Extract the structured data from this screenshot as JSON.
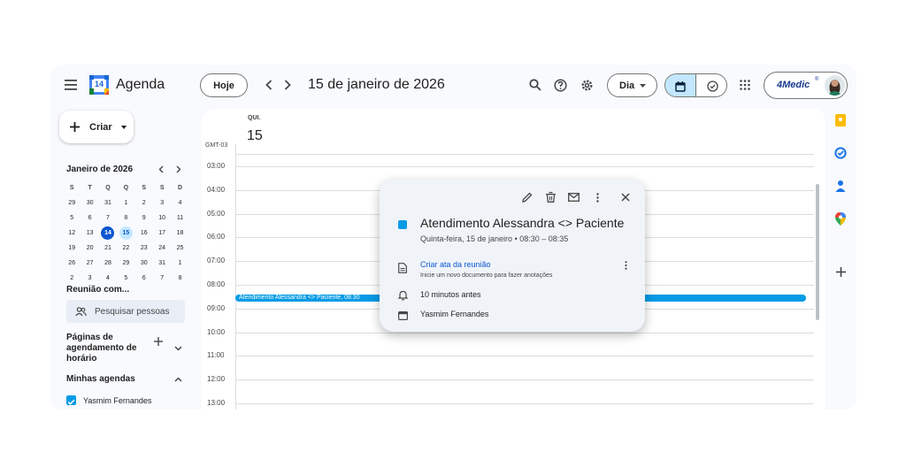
{
  "header": {
    "app_title": "Agenda",
    "calendar_logo_day": "14",
    "today_button": "Hoje",
    "prev_icon": "chevron-left-icon",
    "next_icon": "chevron-right-icon",
    "date_title": "15 de janeiro de 2026",
    "view_select": "Dia",
    "brand": "4Medic",
    "brand_mark": "®"
  },
  "sidebar": {
    "create_label": "Criar",
    "mini_month": "Janeiro de 2026",
    "weekday_headers": [
      "S",
      "T",
      "Q",
      "Q",
      "S",
      "S",
      "D"
    ],
    "weeks": [
      [
        "29",
        "30",
        "31",
        "1",
        "2",
        "3",
        "4"
      ],
      [
        "5",
        "6",
        "7",
        "8",
        "9",
        "10",
        "11"
      ],
      [
        "12",
        "13",
        "14",
        "15",
        "16",
        "17",
        "18"
      ],
      [
        "19",
        "20",
        "21",
        "22",
        "23",
        "24",
        "25"
      ],
      [
        "26",
        "27",
        "28",
        "29",
        "30",
        "31",
        "1"
      ],
      [
        "2",
        "3",
        "4",
        "5",
        "6",
        "7",
        "8"
      ]
    ],
    "today": "14",
    "selected": "15",
    "meet_label": "Reunião com...",
    "search_people": "Pesquisar pessoas",
    "booking_pages": "Páginas de agendamento de horário",
    "my_calendars": "Minhas agendas",
    "calendar_owner": "Yasmim Fernandes"
  },
  "main": {
    "day_label": "QUI.",
    "day_number": "15",
    "timezone": "GMT-03",
    "hours": [
      "03:00",
      "04:00",
      "05:00",
      "06:00",
      "07:00",
      "08:00",
      "09:00",
      "10:00",
      "11:00",
      "12:00",
      "13:00"
    ],
    "event_bar_text": "Atendimento Alessandra <> Paciente, 08:30"
  },
  "popup": {
    "title": "Atendimento Alessandra <> Paciente",
    "when": "Quinta-feira, 15 de janeiro  •  08:30 – 08:35",
    "notes_link": "Criar ata da reunião",
    "notes_hint": "Inicie um novo documento para fazer anotações",
    "reminder": "10 minutos antes",
    "organizer": "Yasmim Fernandes",
    "event_color": "#039be5"
  },
  "colors": {
    "accent": "#0b57d0",
    "event": "#039be5",
    "selected_bg": "#c2e7ff"
  }
}
